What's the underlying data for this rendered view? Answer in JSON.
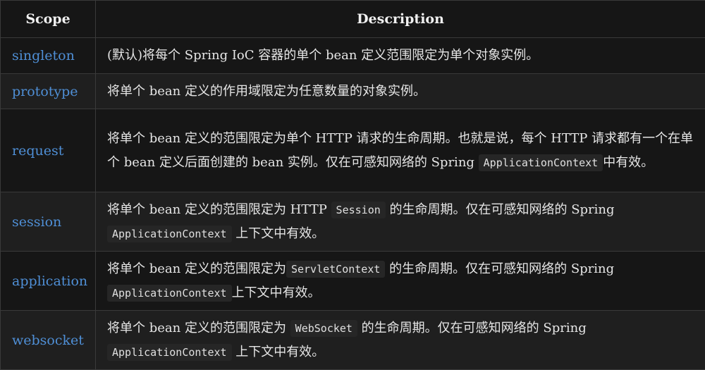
{
  "table": {
    "headers": {
      "scope": "Scope",
      "description": "Description"
    },
    "rows": [
      {
        "scope": "singleton",
        "parts": [
          "(默认)将每个 Spring IoC 容器的单个 bean 定义范围限定为单个对象实例。"
        ]
      },
      {
        "scope": "prototype",
        "parts": [
          "将单个 bean 定义的作用域限定为任意数量的对象实例。"
        ]
      },
      {
        "scope": "request",
        "parts": [
          "将单个 bean 定义的范围限定为单个 HTTP 请求的生命周期。也就是说，每个 HTTP 请求都有一个在单个 bean 定义后面创建的 bean 实例。仅在可感知网络的 Spring ",
          "ApplicationContext",
          "中有效。"
        ]
      },
      {
        "scope": "session",
        "parts": [
          "将单个 bean 定义的范围限定为 HTTP ",
          "Session",
          " 的生命周期。仅在可感知网络的 Spring ",
          "ApplicationContext",
          " 上下文中有效。"
        ]
      },
      {
        "scope": "application",
        "parts": [
          "将单个 bean 定义的范围限定为",
          "ServletContext",
          " 的生命周期。仅在可感知网络的 Spring ",
          "ApplicationContext",
          "上下文中有效。"
        ]
      },
      {
        "scope": "websocket",
        "parts": [
          "将单个 bean 定义的范围限定为 ",
          "WebSocket",
          " 的生命周期。仅在可感知网络的 Spring ",
          "ApplicationContext",
          " 上下文中有效。"
        ]
      }
    ]
  },
  "colors": {
    "background": "#0d0d0d",
    "scope_link": "#4f8fd6",
    "text": "#e6e6e6",
    "code_background": "#262626",
    "border": "#3a3a3a"
  }
}
